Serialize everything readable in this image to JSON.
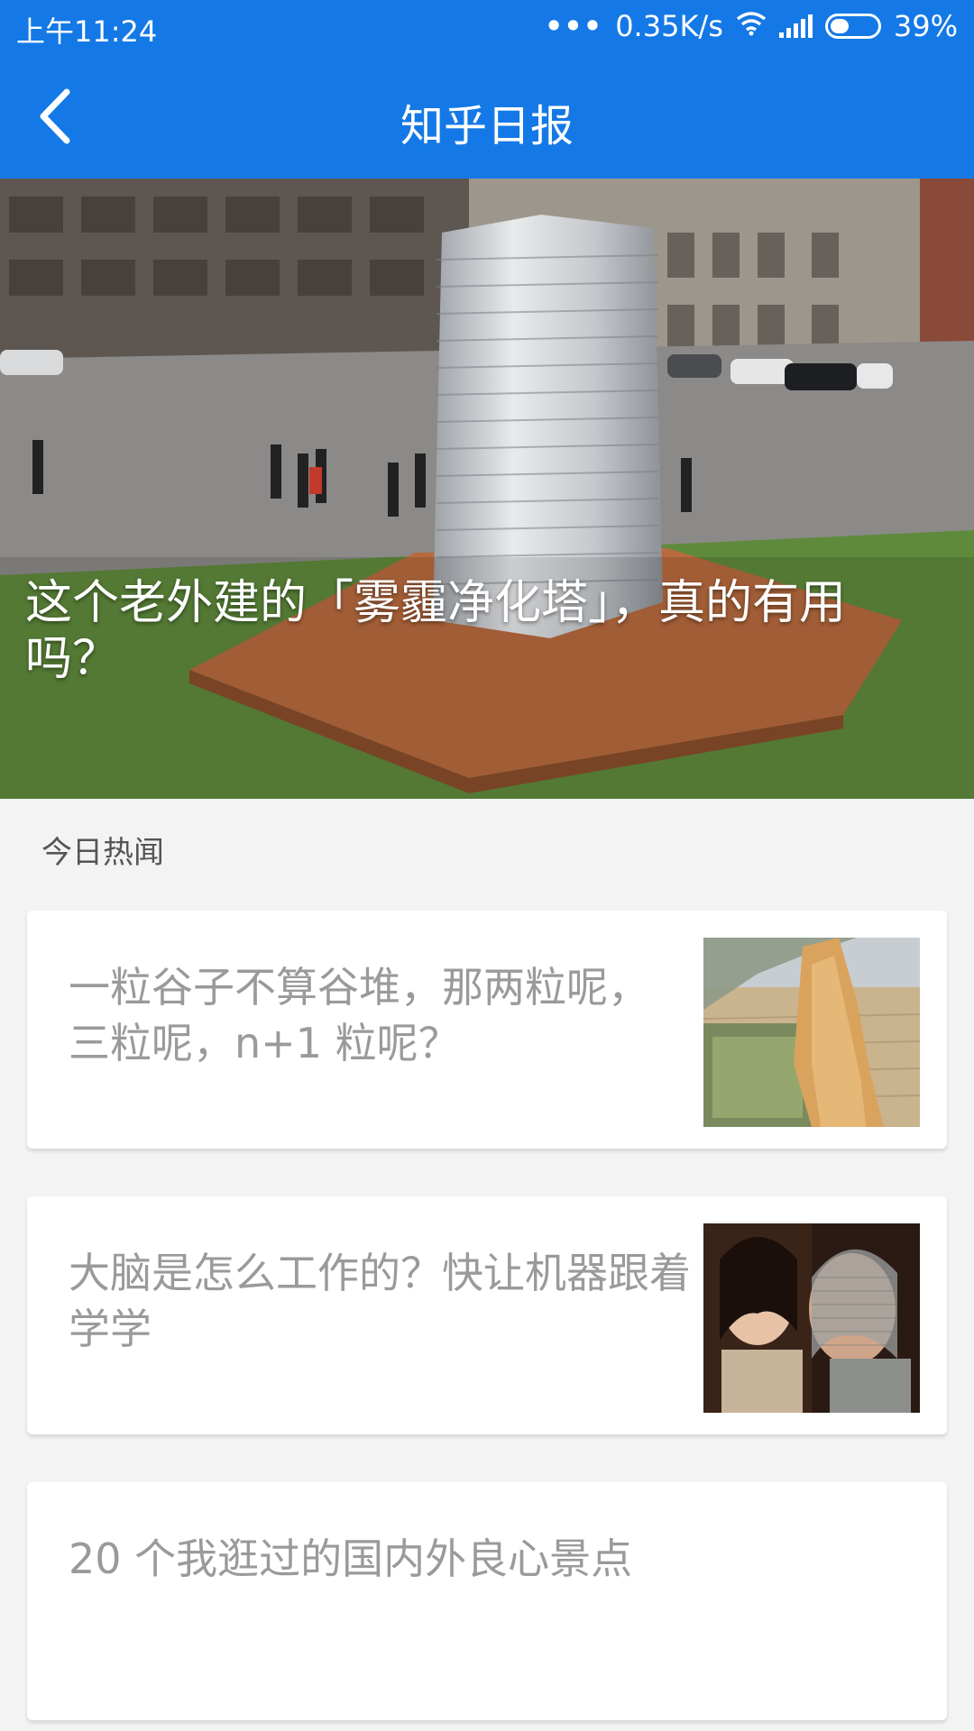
{
  "status_bar": {
    "time": "上午11:24",
    "network_speed": "0.35K/s",
    "battery_percent": "39%",
    "battery_level": 0.39,
    "icons": [
      "more-dots-icon",
      "wifi-icon",
      "signal-icon",
      "battery-icon"
    ]
  },
  "app_bar": {
    "title": "知乎日报",
    "back_icon": "back-chevron-icon"
  },
  "hero": {
    "title": "这个老外建的「雾霾净化塔」，真的有用吗？"
  },
  "section": {
    "title": "今日热闻"
  },
  "stories": [
    {
      "title": "一粒谷子不算谷堆，那两粒呢，三粒呢，n+1 粒呢？",
      "has_thumbnail": true
    },
    {
      "title": "大脑是怎么工作的？快让机器跟着学学",
      "has_thumbnail": true
    },
    {
      "title": "20 个我逛过的国内外良心景点",
      "has_thumbnail": false
    }
  ],
  "colors": {
    "primary": "#1479e6",
    "background": "#f3f3f3",
    "card_text": "#9a9a9a"
  }
}
